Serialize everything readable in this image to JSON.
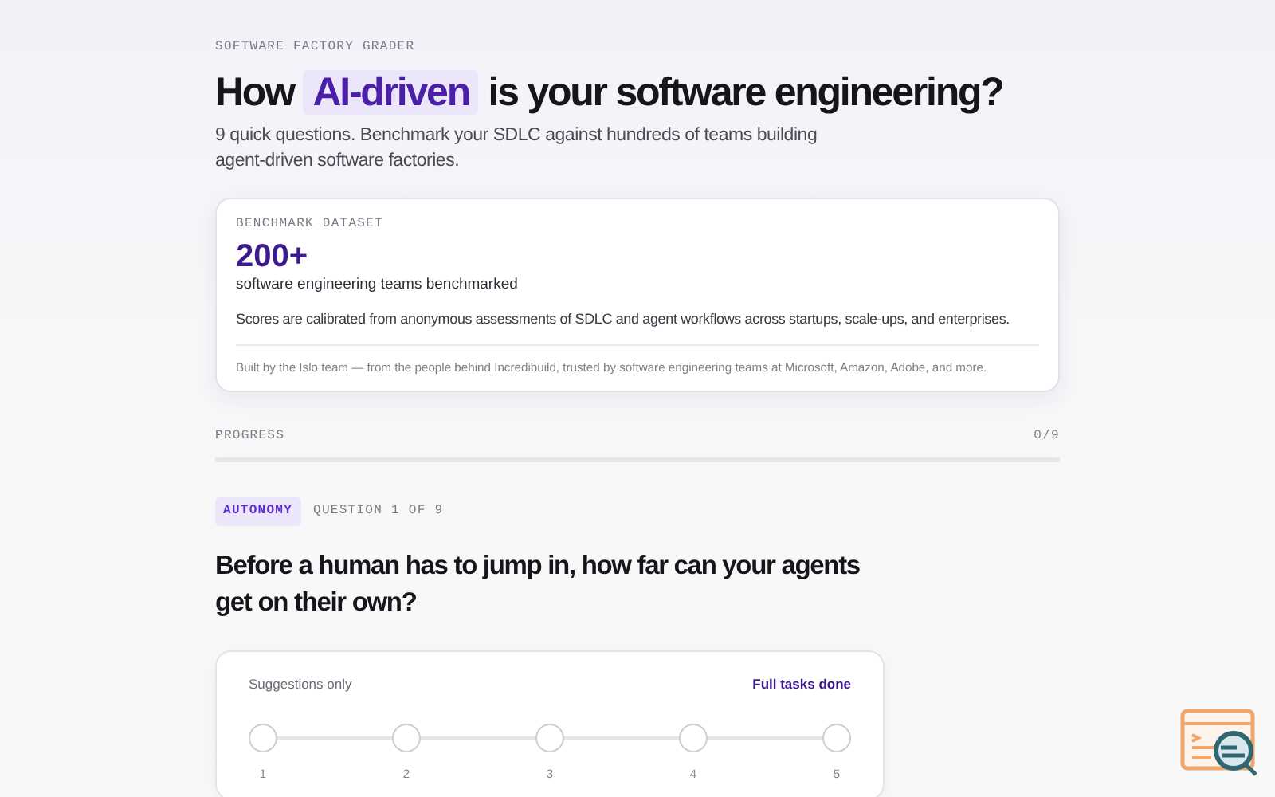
{
  "eyebrow": "SOFTWARE FACTORY GRADER",
  "headline": {
    "before": "How",
    "highlight": "AI-driven",
    "after": "is your software engineering?"
  },
  "intro": "9 quick questions. Benchmark your SDLC against hundreds of teams building agent-driven software factories.",
  "benchmark": {
    "label": "BENCHMARK DATASET",
    "stat": "200+",
    "stat_caption": "software engineering teams benchmarked",
    "description": "Scores are calibrated from anonymous assessments of SDLC and agent workflows across startups, scale-ups, and enterprises.",
    "footnote": "Built by the Islo team — from the people behind Incredibuild, trusted by software engineering teams at Microsoft, Amazon, Adobe, and more."
  },
  "progress": {
    "label": "PROGRESS",
    "count": "0/9",
    "level": 0
  },
  "question": {
    "category": "AUTONOMY",
    "number": "QUESTION 1 OF 9",
    "text": "Before a human has to jump in, how far can your agents get on their own?",
    "scale": {
      "min_label": "Suggestions only",
      "max_label": "Full tasks done",
      "options": [
        {
          "label": "1",
          "selected": false
        },
        {
          "label": "2",
          "selected": false
        },
        {
          "label": "3",
          "selected": false
        },
        {
          "label": "4",
          "selected": false
        },
        {
          "label": "5",
          "selected": false
        }
      ]
    }
  }
}
